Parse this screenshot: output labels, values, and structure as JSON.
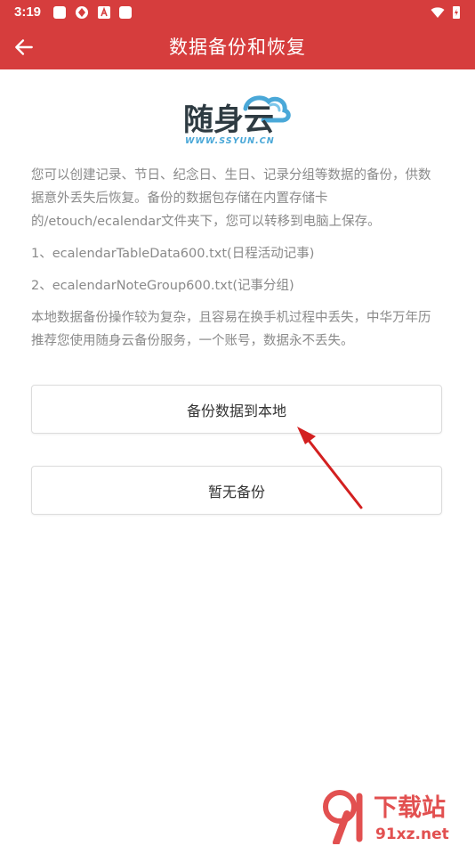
{
  "status_bar": {
    "time": "3:19"
  },
  "app_bar": {
    "title": "数据备份和恢复",
    "back_icon": "arrow-left-icon"
  },
  "logo": {
    "text": "随身云",
    "subtext": "WWW.SSYUN.CN"
  },
  "content": {
    "intro": "您可以创建记录、节日、纪念日、生日、记录分组等数据的备份，供数据意外丢失后恢复。备份的数据包存储在内置存储卡的/etouch/ecalendar文件夹下，您可以转移到电脑上保存。",
    "item1": "1、ecalendarTableData600.txt(日程活动记事)",
    "item2": "2、ecalendarNoteGroup600.txt(记事分组)",
    "note": "本地数据备份操作较为复杂，且容易在换手机过程中丢失，中华万年历推荐您使用随身云备份服务，一个账号，数据永不丢失。"
  },
  "buttons": {
    "backup_local": "备份数据到本地",
    "no_backup": "暂无备份"
  },
  "watermark": {
    "text": "下载站",
    "url": "91xz.net"
  },
  "colors": {
    "primary": "#d63d3d",
    "text_muted": "#8a8a8a",
    "annotation_arrow": "#d32020"
  }
}
